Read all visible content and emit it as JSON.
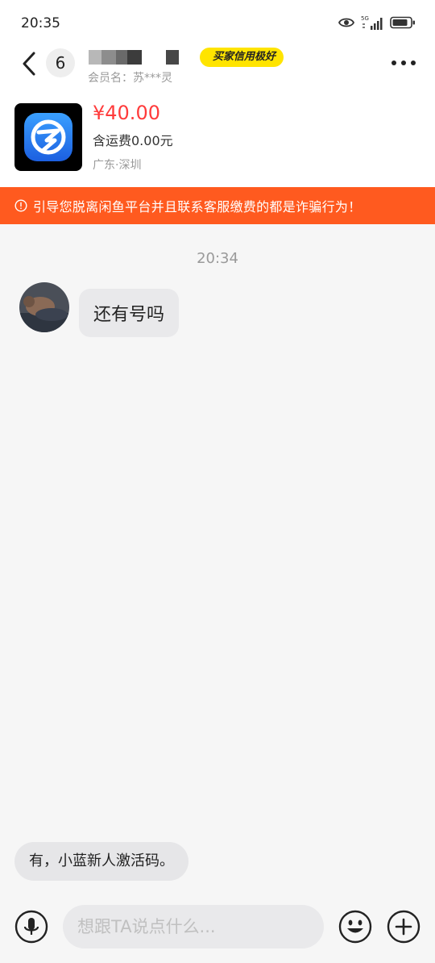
{
  "status_bar": {
    "time": "20:35",
    "icons": [
      "eye-icon",
      "signal-5g-icon",
      "battery-icon"
    ],
    "network_label": "5G"
  },
  "header": {
    "unread_count": "6",
    "credit_badge": "买家信用极好",
    "member_line": "会员名：苏***灵",
    "icons": [
      "back-arrow-icon",
      "more-dots-icon"
    ]
  },
  "product": {
    "price": "¥40.00",
    "shipping": "含运费0.00元",
    "location": "广东·深圳",
    "thumb_icon": "app-logo-icon"
  },
  "warning": {
    "text": "引导您脱离闲鱼平台并且联系客服缴费的都是诈骗行为！",
    "color": "#ff5a1f"
  },
  "conversation": {
    "time": "20:34",
    "messages": [
      {
        "from": "other",
        "text": "还有号吗"
      }
    ]
  },
  "quick_reply": {
    "text": "有，小蓝新人激活码。"
  },
  "input_bar": {
    "placeholder": "想跟TA说点什么...",
    "icons": [
      "microphone-icon",
      "emoji-icon",
      "plus-icon"
    ]
  },
  "colors": {
    "price": "#ff3b3b",
    "badge": "#ffe400",
    "background": "#f6f6f6"
  }
}
